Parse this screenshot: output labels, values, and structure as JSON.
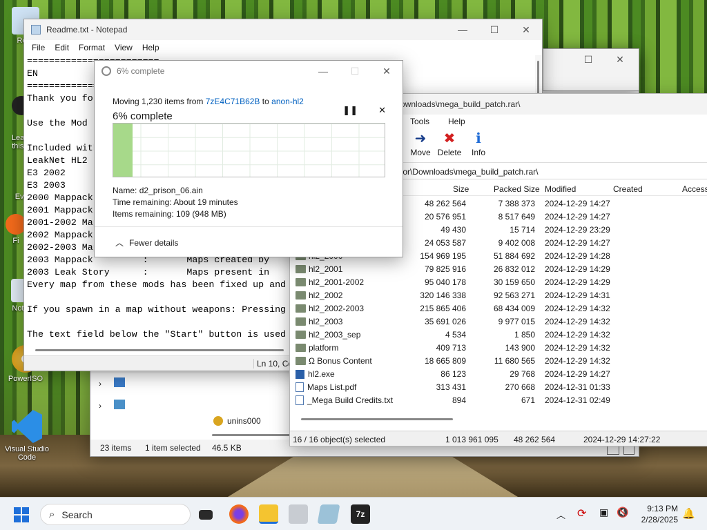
{
  "desktop": {
    "icons": [
      {
        "label": "Recy"
      },
      {
        "label": "Learn\nthis P"
      },
      {
        "label": "Ever"
      },
      {
        "label": "Fi"
      },
      {
        "label": "Note"
      },
      {
        "label": "PowerISO"
      },
      {
        "label": "Visual Studio Code"
      }
    ]
  },
  "notepad": {
    "title": "Readme.txt - Notepad",
    "menu": [
      "File",
      "Edit",
      "Format",
      "View",
      "Help"
    ],
    "lines": [
      "========================",
      "EN",
      "========================",
      "Thank you fo",
      "",
      "Use the Mod ",
      "",
      "Included with",
      "LeakNet HL2 ",
      "E3 2002",
      "E3 2003",
      "2000 Mappack",
      "2001 Mappack",
      "2001-2002 Map",
      "2002 Mappack",
      "2002-2003 Map",
      "2003 Mappack         :       Maps created by",
      "2003 Leak Story      :       Maps present in",
      "Every map from these mods has been fixed up and",
      "",
      "If you spawn in a map without weapons: Pressing",
      "",
      "The text field below the \"Start\" button is used"
    ],
    "status": "Ln 10, Col"
  },
  "progress": {
    "title": "6% complete",
    "moving_prefix": "Moving 1,230 items from ",
    "from": "7zE4C71B62B",
    "to_word": " to ",
    "to": "anon-hl2",
    "percent_label": "6% complete",
    "percent": 6,
    "name_label": "Name:",
    "name": "d2_prison_06.ain",
    "time_label": "Time remaining:",
    "time": "About 19 minutes",
    "items_label": "Items remaining:",
    "items": "109 (948 MB)",
    "fewer": "Fewer details"
  },
  "explorer": {
    "status_items": "23 items",
    "status_selected": "1 item selected",
    "status_size": "46.5 KB",
    "tree_item": "unins000"
  },
  "sevenzip": {
    "title": "ownloads\\mega_build_patch.rar\\",
    "menu": [
      "Tools",
      "Help"
    ],
    "toolbar": [
      {
        "label": "Move",
        "icon": "move-arrow"
      },
      {
        "label": "Delete",
        "icon": "delete-x"
      },
      {
        "label": "Info",
        "icon": "info-i"
      }
    ],
    "address": "tor\\Downloads\\mega_build_patch.rar\\",
    "columns": [
      "Size",
      "Packed Size",
      "Modified",
      "Created",
      "Access"
    ],
    "rows": [
      {
        "name": "",
        "type": "folder",
        "size": "48 262 564",
        "packed": "7 388 373",
        "modified": "2024-12-29 14:27"
      },
      {
        "name": "",
        "type": "folder",
        "size": "20 576 951",
        "packed": "8 517 649",
        "modified": "2024-12-29 14:27"
      },
      {
        "name": "",
        "type": "folder",
        "size": "49 430",
        "packed": "15 714",
        "modified": "2024-12-29 23:29"
      },
      {
        "name": "",
        "type": "folder",
        "size": "24 053 587",
        "packed": "9 402 008",
        "modified": "2024-12-29 14:27"
      },
      {
        "name": "hl2_2000",
        "type": "folder",
        "size": "154 969 195",
        "packed": "51 884 692",
        "modified": "2024-12-29 14:28"
      },
      {
        "name": "hl2_2001",
        "type": "folder",
        "size": "79 825 916",
        "packed": "26 832 012",
        "modified": "2024-12-29 14:29"
      },
      {
        "name": "hl2_2001-2002",
        "type": "folder",
        "size": "95 040 178",
        "packed": "30 159 650",
        "modified": "2024-12-29 14:29"
      },
      {
        "name": "hl2_2002",
        "type": "folder",
        "size": "320 146 338",
        "packed": "92 563 271",
        "modified": "2024-12-29 14:31"
      },
      {
        "name": "hl2_2002-2003",
        "type": "folder",
        "size": "215 865 406",
        "packed": "68 434 009",
        "modified": "2024-12-29 14:32"
      },
      {
        "name": "hl2_2003",
        "type": "folder",
        "size": "35 691 026",
        "packed": "9 977 015",
        "modified": "2024-12-29 14:32"
      },
      {
        "name": "hl2_2003_sep",
        "type": "folder",
        "size": "4 534",
        "packed": "1 850",
        "modified": "2024-12-29 14:32"
      },
      {
        "name": "platform",
        "type": "folder",
        "size": "409 713",
        "packed": "143 900",
        "modified": "2024-12-29 14:32"
      },
      {
        "name": "Ω Bonus Content",
        "type": "folder",
        "size": "18 665 809",
        "packed": "11 680 565",
        "modified": "2024-12-29 14:32"
      },
      {
        "name": "hl2.exe",
        "type": "exe",
        "size": "86 123",
        "packed": "29 768",
        "modified": "2024-12-29 14:27"
      },
      {
        "name": "Maps List.pdf",
        "type": "file",
        "size": "313 431",
        "packed": "270 668",
        "modified": "2024-12-31 01:33"
      },
      {
        "name": "_Mega Build Credits.txt",
        "type": "file",
        "size": "894",
        "packed": "671",
        "modified": "2024-12-31 02:49"
      }
    ],
    "status": {
      "selected": "16 / 16 object(s) selected",
      "total": "1 013 961 095",
      "packed": "48 262 564",
      "date": "2024-12-29 14:27:22"
    }
  },
  "taskbar": {
    "search_placeholder": "Search",
    "time": "9:13 PM",
    "date": "2/28/2025"
  }
}
